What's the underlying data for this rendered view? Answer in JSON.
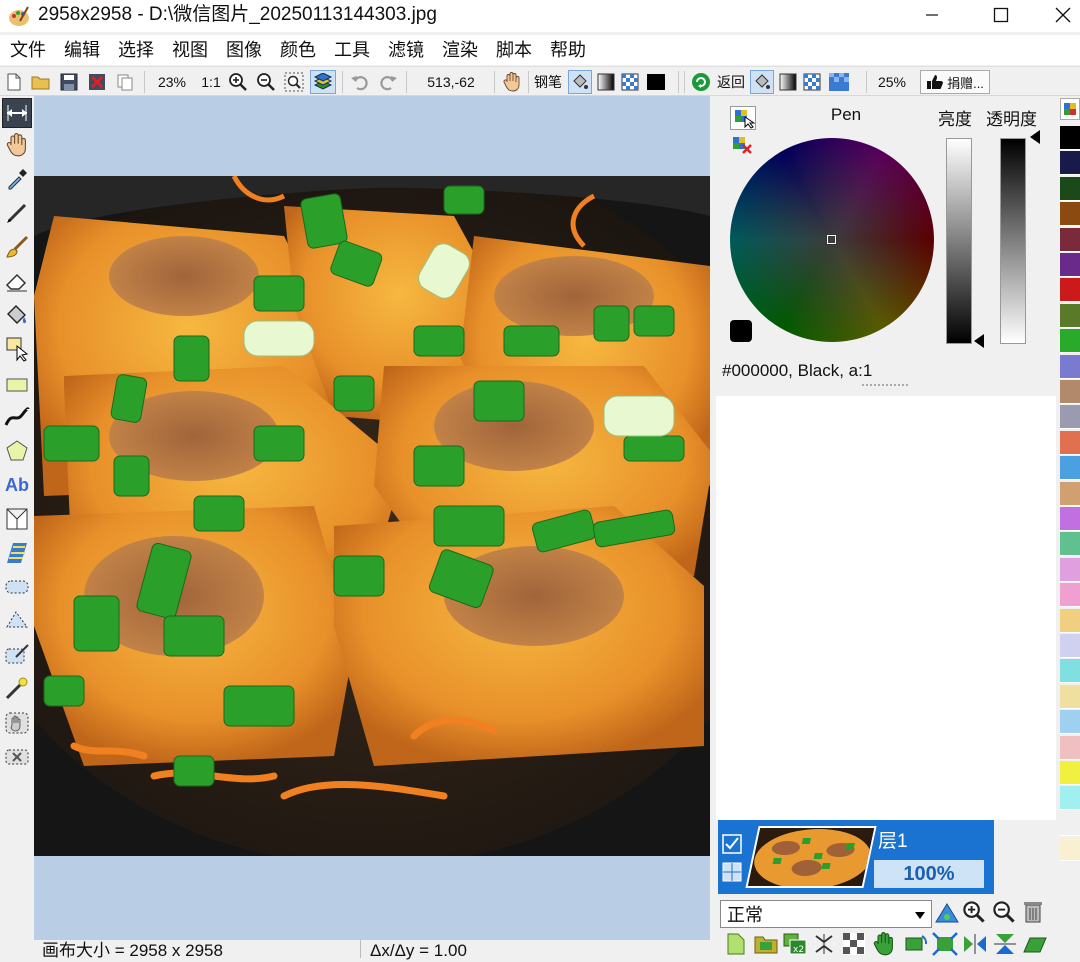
{
  "window": {
    "title": "2958x2958 - D:\\微信图片_20250113144303.jpg",
    "minimize_icon": "minimize-icon",
    "maximize_icon": "maximize-icon",
    "close_icon": "close-icon"
  },
  "menu": [
    "文件",
    "编辑",
    "选择",
    "视图",
    "图像",
    "颜色",
    "工具",
    "滤镜",
    "渲染",
    "脚本",
    "帮助"
  ],
  "toolbar": {
    "zoom": "23%",
    "actual_size": "1:1",
    "cursor_pos": "513,-62",
    "brush_label": "钢笔",
    "back_label": "返回",
    "zoom2": "25%",
    "donate_label": "捐赠..."
  },
  "color_panel": {
    "pen_label": "Pen",
    "brightness_label": "亮度",
    "opacity_label": "透明度",
    "color_readout": "#000000, Black, a:1"
  },
  "layers": {
    "name": "层1",
    "opacity": "100%",
    "blend_mode": "正常"
  },
  "status": {
    "canvas_size": "画布大小 = 2958 x 2958",
    "delta": "Δx/Δy = 1.00"
  },
  "palette": [
    "#000000",
    "#1a1a4a",
    "#1a4a1a",
    "#8a4a10",
    "#7a2a3a",
    "#6a2a8a",
    "#cc1a1a",
    "#5a7a2a",
    "#2aaa2a",
    "#7a7ad0",
    "#b08a6a",
    "#9a9ab0",
    "#e07050",
    "#4aa0e0",
    "#d0a070",
    "#c070e0",
    "#60c090",
    "#e0a0e0",
    "#f0a0d0",
    "#f0d080",
    "#d0d0f0",
    "#80e0e0",
    "#f0e0a0",
    "#a0d0f0",
    "#f0c0c0",
    "#f0f040",
    "#a0f0f0",
    "#f0f0f0",
    "#f8f0d0"
  ]
}
